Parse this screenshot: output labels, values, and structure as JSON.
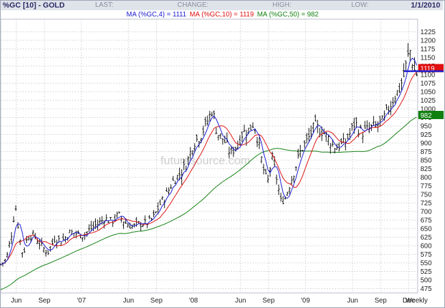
{
  "header": {
    "symbol": "%GC [10] - GOLD",
    "last_label": "LAST:",
    "change_label": "CHANGE:",
    "high_label": "HIGH:",
    "low_label": "LOW:",
    "date": "1/1/2010"
  },
  "legend": [
    {
      "text": "MA (%GC,4) = 1111",
      "color": "#1a1ad0"
    },
    {
      "text": "MA (%GC,10) = 1119",
      "color": "#e01010"
    },
    {
      "text": "MA (%GC,50) = 982",
      "color": "#108010"
    }
  ],
  "watermark": "futuresource.com",
  "chart_data": {
    "type": "line",
    "style": "OHLC bars with moving averages",
    "interval": "Weekly",
    "ylim": [
      462,
      1262
    ],
    "ytick_values": [
      475,
      500,
      525,
      550,
      575,
      600,
      625,
      650,
      675,
      700,
      725,
      750,
      775,
      800,
      825,
      850,
      875,
      900,
      925,
      950,
      975,
      1000,
      1025,
      1050,
      1075,
      1100,
      1125,
      1150,
      1175,
      1200,
      1225
    ],
    "xlim": [
      2006.28,
      2010.0
    ],
    "x_tick_labels": [
      {
        "label": "Jun",
        "x": 2006.42
      },
      {
        "label": "Sep",
        "x": 2006.67
      },
      {
        "label": "'07",
        "x": 2007.0
      },
      {
        "label": "Jun",
        "x": 2007.42
      },
      {
        "label": "Sep",
        "x": 2007.67
      },
      {
        "label": "'08",
        "x": 2008.0
      },
      {
        "label": "Jun",
        "x": 2008.42
      },
      {
        "label": "Sep",
        "x": 2008.67
      },
      {
        "label": "'09",
        "x": 2009.0
      },
      {
        "label": "Jun",
        "x": 2009.42
      },
      {
        "label": "Sep",
        "x": 2009.67
      },
      {
        "label": "Dec",
        "x": 2009.92
      },
      {
        "label": "Weekly",
        "x": 2010.09
      }
    ],
    "price_keypoints": [
      [
        2006.28,
        545
      ],
      [
        2006.33,
        560
      ],
      [
        2006.38,
        640
      ],
      [
        2006.41,
        720
      ],
      [
        2006.45,
        620
      ],
      [
        2006.48,
        570
      ],
      [
        2006.52,
        630
      ],
      [
        2006.58,
        630
      ],
      [
        2006.64,
        600
      ],
      [
        2006.7,
        580
      ],
      [
        2006.76,
        620
      ],
      [
        2006.83,
        615
      ],
      [
        2006.9,
        640
      ],
      [
        2006.96,
        635
      ],
      [
        2007.02,
        630
      ],
      [
        2007.08,
        650
      ],
      [
        2007.15,
        665
      ],
      [
        2007.21,
        680
      ],
      [
        2007.27,
        670
      ],
      [
        2007.33,
        690
      ],
      [
        2007.4,
        665
      ],
      [
        2007.46,
        655
      ],
      [
        2007.52,
        665
      ],
      [
        2007.58,
        665
      ],
      [
        2007.64,
        680
      ],
      [
        2007.7,
        720
      ],
      [
        2007.76,
        750
      ],
      [
        2007.82,
        790
      ],
      [
        2007.88,
        810
      ],
      [
        2007.94,
        840
      ],
      [
        2008.0,
        900
      ],
      [
        2008.06,
        920
      ],
      [
        2008.12,
        960
      ],
      [
        2008.17,
        1000
      ],
      [
        2008.21,
        930
      ],
      [
        2008.27,
        910
      ],
      [
        2008.33,
        870
      ],
      [
        2008.38,
        890
      ],
      [
        2008.44,
        930
      ],
      [
        2008.5,
        940
      ],
      [
        2008.54,
        960
      ],
      [
        2008.58,
        900
      ],
      [
        2008.62,
        830
      ],
      [
        2008.66,
        780
      ],
      [
        2008.7,
        860
      ],
      [
        2008.74,
        800
      ],
      [
        2008.78,
        730
      ],
      [
        2008.82,
        740
      ],
      [
        2008.86,
        780
      ],
      [
        2008.92,
        840
      ],
      [
        2008.96,
        880
      ],
      [
        2009.02,
        910
      ],
      [
        2009.08,
        950
      ],
      [
        2009.13,
        940
      ],
      [
        2009.19,
        920
      ],
      [
        2009.25,
        890
      ],
      [
        2009.29,
        890
      ],
      [
        2009.35,
        900
      ],
      [
        2009.4,
        930
      ],
      [
        2009.44,
        960
      ],
      [
        2009.5,
        930
      ],
      [
        2009.56,
        940
      ],
      [
        2009.62,
        950
      ],
      [
        2009.68,
        960
      ],
      [
        2009.74,
        1000
      ],
      [
        2009.8,
        1040
      ],
      [
        2009.84,
        1060
      ],
      [
        2009.88,
        1100
      ],
      [
        2009.91,
        1150
      ],
      [
        2009.935,
        1170
      ],
      [
        2009.96,
        1125
      ],
      [
        2009.98,
        1105
      ],
      [
        2010.0,
        1100
      ]
    ],
    "series": [
      {
        "name": "MA (%GC,4)",
        "value": 1111,
        "color": "#1a1ad0"
      },
      {
        "name": "MA (%GC,10)",
        "value": 1119,
        "color": "#e01010"
      },
      {
        "name": "MA (%GC,50)",
        "value": 982,
        "color": "#108010"
      }
    ],
    "price_marker": {
      "value": 1119,
      "color": "#e01010"
    },
    "ma50_marker": {
      "value": 982,
      "color": "#108010"
    },
    "grid": true,
    "axis_side": "right"
  }
}
